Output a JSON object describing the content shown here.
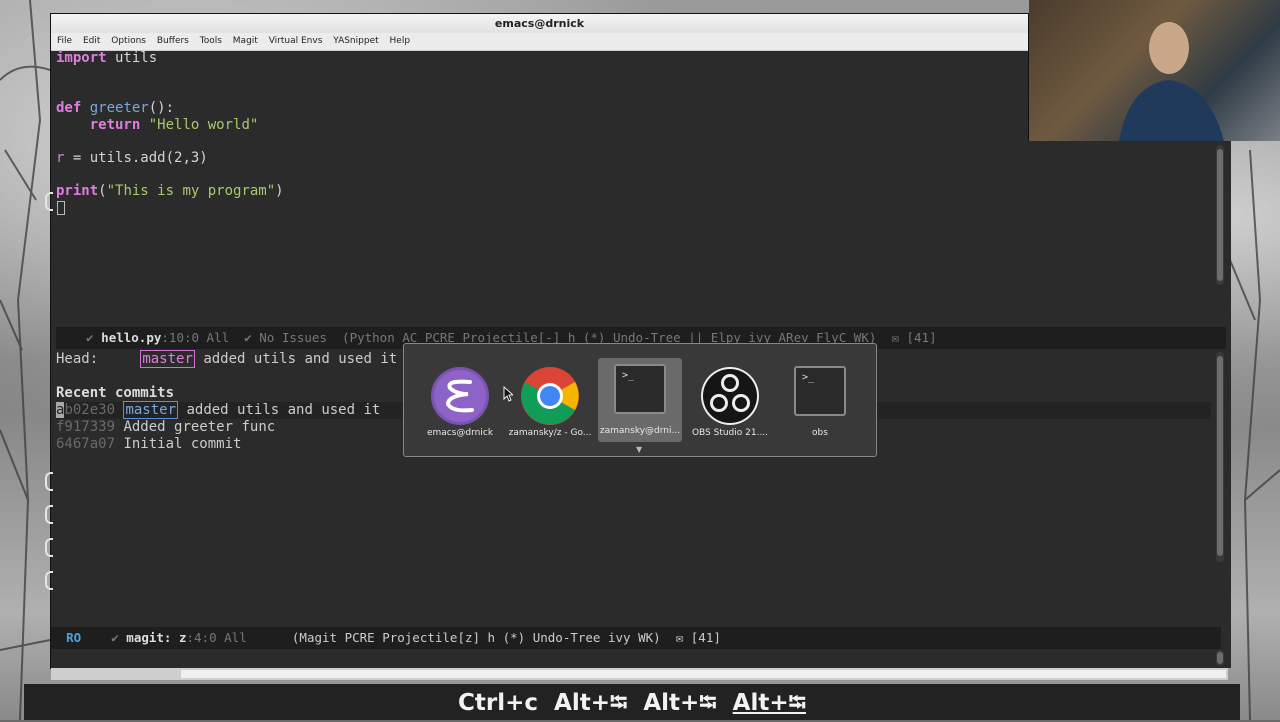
{
  "window": {
    "title": "emacs@drnick"
  },
  "menu": [
    "File",
    "Edit",
    "Options",
    "Buffers",
    "Tools",
    "Magit",
    "Virtual Envs",
    "YASnippet",
    "Help"
  ],
  "editor": {
    "lines": {
      "l1_kw": "import",
      "l1_rest": " utils",
      "l2_kw": "def",
      "l2_fn": "greeter",
      "l2_rest": "():",
      "l3_kw": "    return",
      "l3_str": " \"Hello world\"",
      "l4_var": "r",
      "l4_rest": " = utils.add(2,3)",
      "l5_fn": "print",
      "l5_open": "(",
      "l5_str": "\"This is my program\"",
      "l5_close": ")"
    },
    "modeline": {
      "check": "✔",
      "filename": "hello.py",
      "position": ":10:0 All",
      "issues": "✔ No Issues",
      "modes": "(Python AC PCRE Projectile[-] h (*) Undo-Tree || Elpy ivy ARev FlyC WK)",
      "mail": "✉ [41]"
    }
  },
  "magit": {
    "head_label": "Head:",
    "head_branch": "master",
    "head_message": "added utils and used it",
    "section_title": "Recent commits",
    "commits": [
      {
        "hash_first": "a",
        "hash_rest": "b02e30",
        "branch": "master",
        "message": "added utils and used it"
      },
      {
        "hash": "f917339",
        "message": "Added greeter func"
      },
      {
        "hash": "6467a07",
        "message": "Initial commit"
      }
    ],
    "modeline": {
      "ro": "RO",
      "check": "✔",
      "buffer": "magit:",
      "name": "z",
      "position": ":4:0 All",
      "modes": "(Magit PCRE Projectile[z] h (*) Undo-Tree ivy WK)",
      "mail": "✉ [41]"
    }
  },
  "switcher": {
    "items": [
      {
        "label": "emacs@drnick",
        "icon": "emacs-icon"
      },
      {
        "label": "zamansky/z - Go...",
        "icon": "chrome-icon"
      },
      {
        "label": "zamansky@drni...",
        "icon": "terminal-icon",
        "active": true
      },
      {
        "label": "OBS Studio 21....",
        "icon": "obs-icon"
      },
      {
        "label": "obs",
        "icon": "terminal-icon"
      }
    ],
    "prompt_glyph": ">_"
  },
  "keys": [
    "Ctrl+c",
    "Alt+⭾",
    "Alt+⭾",
    "Alt+⭾"
  ],
  "colors": {
    "keyword": "#e07ee0",
    "function": "#7aa7e0",
    "string": "#a7c96b",
    "ro": "#4aa3e0"
  }
}
